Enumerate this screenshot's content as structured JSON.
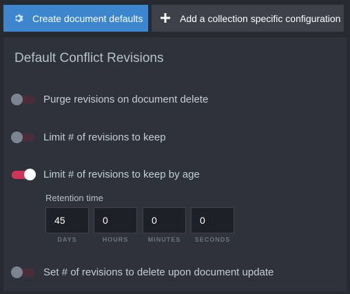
{
  "toolbar": {
    "create_defaults_label": "Create document defaults",
    "add_collection_label": "Add a collection specific configuration"
  },
  "panel": {
    "title": "Default Conflict Revisions",
    "toggles": [
      {
        "label": "Purge revisions on document delete",
        "on": false
      },
      {
        "label": "Limit # of revisions to keep",
        "on": false
      },
      {
        "label": "Limit # of revisions to keep by age",
        "on": true
      },
      {
        "label": "Set # of revisions to delete upon document update",
        "on": false
      }
    ],
    "retention": {
      "label": "Retention time",
      "days": {
        "value": "45",
        "unit": "DAYS"
      },
      "hours": {
        "value": "0",
        "unit": "HOURS"
      },
      "minutes": {
        "value": "0",
        "unit": "MINUTES"
      },
      "seconds": {
        "value": "0",
        "unit": "SECONDS"
      }
    }
  },
  "colors": {
    "primary": "#3b86cd",
    "toggle_on": "#cf3558",
    "toggle_off": "#4a2d38",
    "panel_bg": "#2e333b",
    "page_bg": "#262a31"
  },
  "icons": {
    "create_defaults": "gear-icon",
    "add_collection": "plus-icon"
  }
}
